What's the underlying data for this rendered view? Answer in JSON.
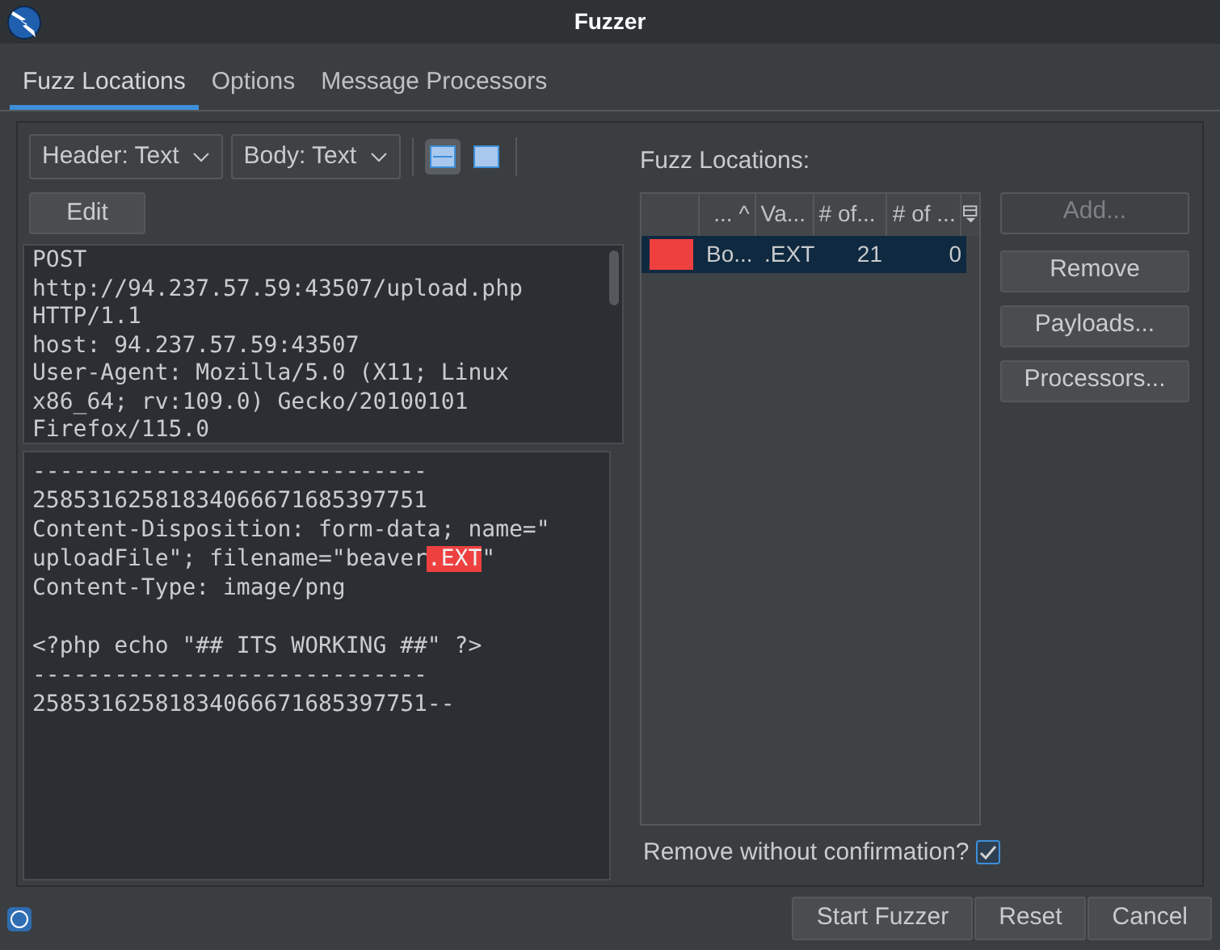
{
  "window": {
    "title": "Fuzzer"
  },
  "tabs": [
    {
      "label": "Fuzz Locations",
      "selected": true
    },
    {
      "label": "Options",
      "selected": false
    },
    {
      "label": "Message Processors",
      "selected": false
    }
  ],
  "toolbar": {
    "header_view": "Header: Text",
    "body_view": "Body: Text",
    "layout_buttons": [
      {
        "selected": true
      },
      {
        "selected": false
      }
    ]
  },
  "edit_button": "Edit",
  "request_header": {
    "lines": [
      "POST",
      "http://94.237.57.59:43507/upload.php",
      "HTTP/1.1",
      "host: 94.237.57.59:43507",
      "User-Agent: Mozilla/5.0 (X11; Linux",
      "x86_64; rv:109.0) Gecko/20100101",
      "Firefox/115.0"
    ]
  },
  "request_body": {
    "blocks": [
      {
        "lines": [
          {
            "segments": [
              {
                "text": "-----------------------------",
                "highlighted": false
              }
            ]
          },
          {
            "segments": [
              {
                "text": "25853162581834066671685397751",
                "highlighted": false
              }
            ]
          },
          {
            "segments": [
              {
                "text": "Content-Disposition: form-data; name=\"",
                "highlighted": false
              }
            ]
          },
          {
            "segments": [
              {
                "text": "uploadFile\"; filename=\"beaver",
                "highlighted": false
              },
              {
                "text": ".EXT",
                "highlighted": true
              },
              {
                "text": "\"",
                "highlighted": false
              }
            ]
          },
          {
            "segments": [
              {
                "text": "Content-Type: image/png",
                "highlighted": false
              }
            ]
          }
        ]
      },
      {
        "lines": [
          {
            "segments": [
              {
                "text": "<?php echo \"## ITS WORKING ##\" ?>",
                "highlighted": false
              }
            ]
          },
          {
            "segments": [
              {
                "text": "-----------------------------",
                "highlighted": false
              }
            ]
          },
          {
            "segments": [
              {
                "text": "25853162581834066671685397751--",
                "highlighted": false
              }
            ]
          }
        ]
      }
    ]
  },
  "fuzz_locations": {
    "label": "Fuzz Locations:",
    "columns": [
      "... ^",
      "Va...",
      "# of...",
      "# of ..."
    ],
    "rows": [
      {
        "color": "#ef4040",
        "selected": true,
        "cells": [
          "Bo...",
          ".EXT",
          "21",
          "0"
        ]
      }
    ],
    "buttons": [
      {
        "label": "Add...",
        "disabled": true
      },
      {
        "label": "Remove",
        "disabled": false
      },
      {
        "label": "Payloads...",
        "disabled": false
      },
      {
        "label": "Processors...",
        "disabled": false
      }
    ],
    "remove_without_confirmation": {
      "label": "Remove without confirmation?",
      "checked": true
    }
  },
  "footer_buttons": [
    "Start Fuzzer",
    "Reset",
    "Cancel"
  ]
}
